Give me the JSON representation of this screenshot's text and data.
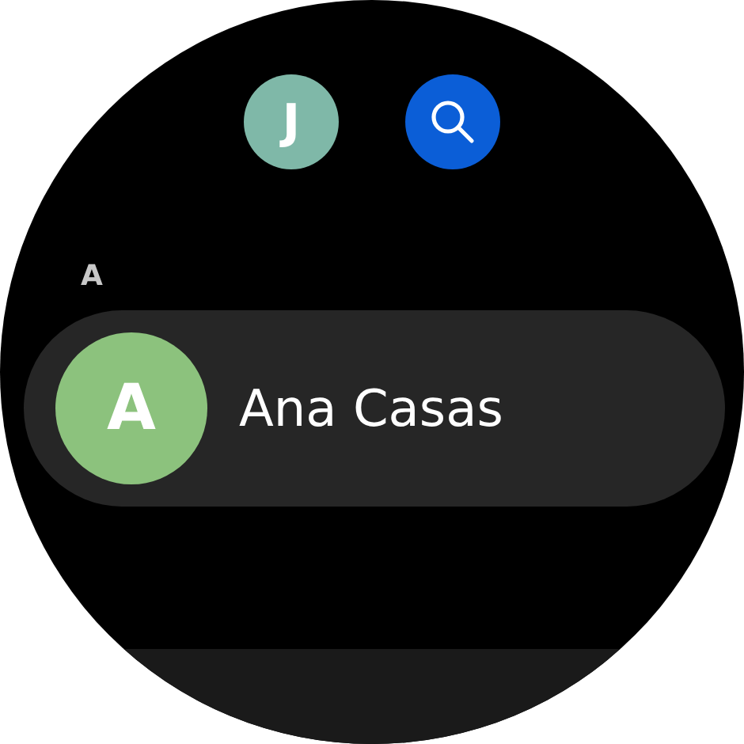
{
  "top_actions": [
    {
      "kind": "avatar",
      "initial": "J",
      "color": "#7fb8a8"
    },
    {
      "kind": "search"
    }
  ],
  "sections": [
    {
      "letter": "A",
      "contacts": [
        {
          "name": "Ana Casas",
          "initial": "A",
          "color": "#8cc27d"
        }
      ]
    }
  ]
}
